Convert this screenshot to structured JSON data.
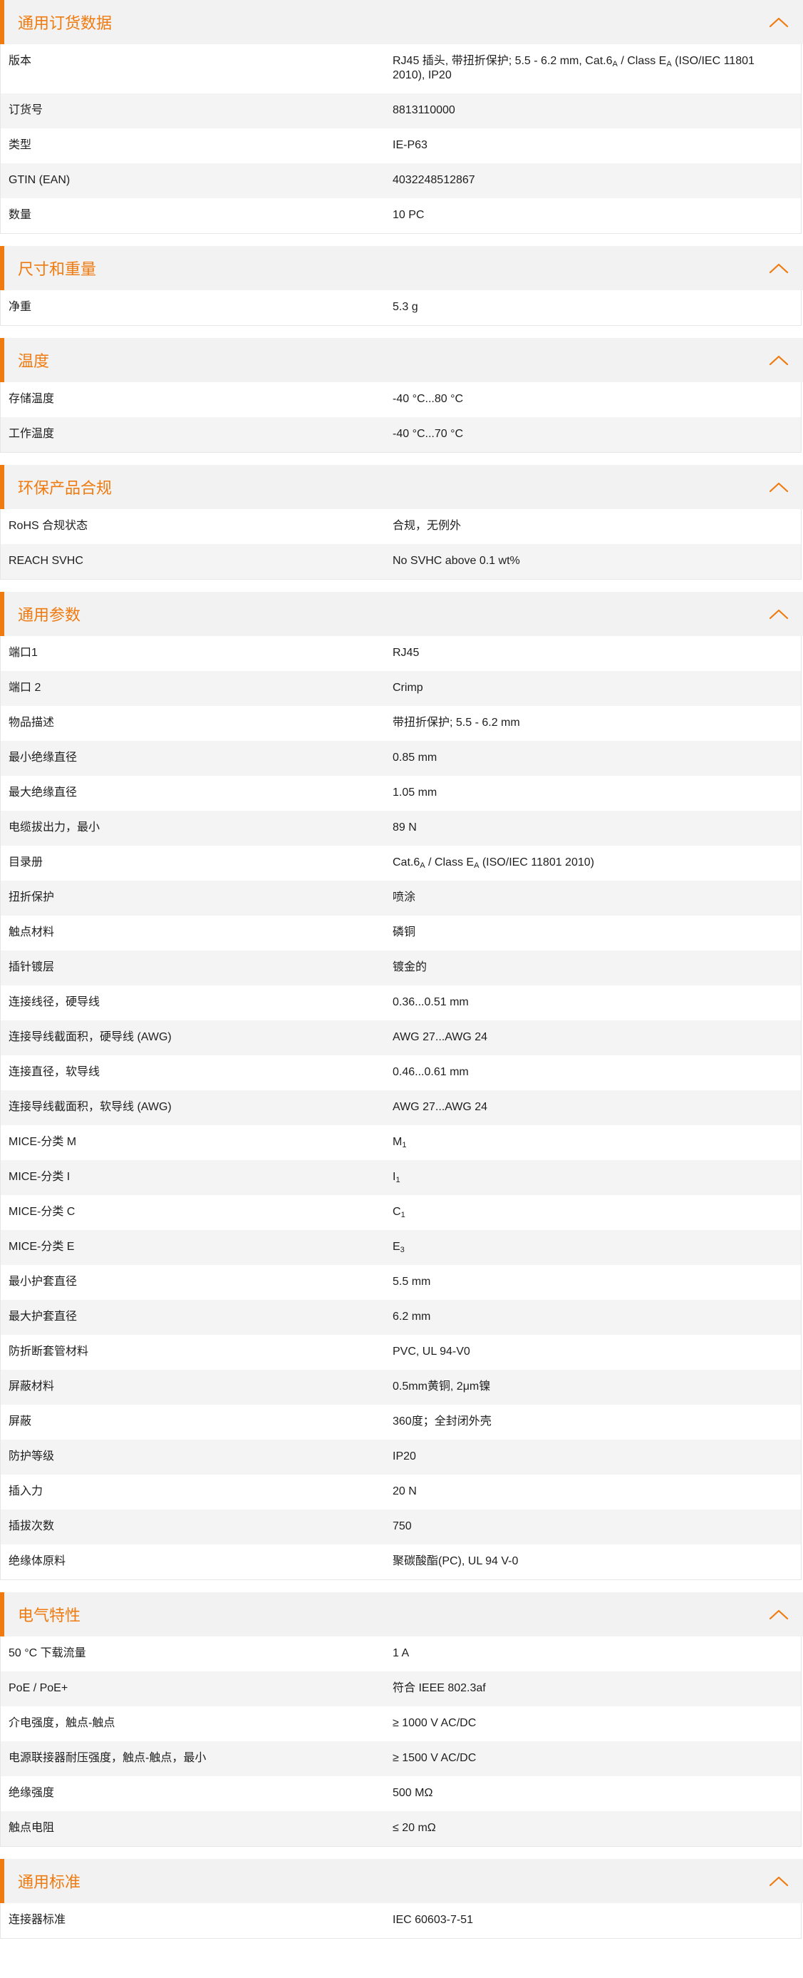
{
  "colors": {
    "accent": "#ef7b10",
    "header_bg": "#f2f2f2",
    "row_alt_bg": "#f4f4f4",
    "text": "#1e1e1e"
  },
  "icons": {
    "collapse": "chevron-up-icon"
  },
  "sections": [
    {
      "title": "通用订货数据",
      "rows": [
        {
          "label": "版本",
          "value": "RJ45 插头, 带扭折保护; 5.5 - 6.2 mm, Cat.6A / Class EA (ISO/IEC 11801 2010), IP20",
          "value_parts": [
            "RJ45 插头, 带扭折保护; 5.5 - 6.2 mm, Cat.6",
            "A",
            " / Class E",
            "A",
            " (ISO/IEC 11801 2010), IP20"
          ],
          "tall": true
        },
        {
          "label": "订货号",
          "value": "8813110000"
        },
        {
          "label": "类型",
          "value": "IE-P63"
        },
        {
          "label": "GTIN (EAN)",
          "value": "4032248512867"
        },
        {
          "label": "数量",
          "value": "10  PC"
        }
      ]
    },
    {
      "title": "尺寸和重量",
      "rows": [
        {
          "label": "净重",
          "value": "5.3  g"
        }
      ]
    },
    {
      "title": "温度",
      "rows": [
        {
          "label": "存储温度",
          "value": "-40 °C...80 °C"
        },
        {
          "label": "工作温度",
          "value": "-40 °C...70 °C"
        }
      ]
    },
    {
      "title": "环保产品合规",
      "rows": [
        {
          "label": "RoHS 合规状态",
          "value": "合规，无例外"
        },
        {
          "label": "REACH SVHC",
          "value": "No SVHC above 0.1 wt%"
        }
      ]
    },
    {
      "title": "通用参数",
      "rows": [
        {
          "label": "端口1",
          "value": "RJ45"
        },
        {
          "label": "端口 2",
          "value": "Crimp"
        },
        {
          "label": "物品描述",
          "value": "带扭折保护; 5.5 - 6.2 mm"
        },
        {
          "label": "最小绝缘直径",
          "value": "0.85  mm"
        },
        {
          "label": "最大绝缘直径",
          "value": "1.05  mm"
        },
        {
          "label": "电缆拔出力，最小",
          "value": "89  N"
        },
        {
          "label": "目录册",
          "value": "Cat.6A / Class EA (ISO/IEC 11801 2010)",
          "value_parts": [
            "Cat.6",
            "A",
            " / Class E",
            "A",
            " (ISO/IEC 11801 2010)"
          ]
        },
        {
          "label": "扭折保护",
          "value": "喷涂"
        },
        {
          "label": "触点材料",
          "value": "磷铜"
        },
        {
          "label": "插针镀层",
          "value": "镀金的"
        },
        {
          "label": "连接线径，硬导线",
          "value": "0.36...0.51 mm"
        },
        {
          "label": "连接导线截面积，硬导线 (AWG)",
          "value": "AWG 27...AWG 24"
        },
        {
          "label": "连接直径，软导线",
          "value": "0.46...0.61 mm"
        },
        {
          "label": "连接导线截面积，软导线 (AWG)",
          "value": "AWG 27...AWG 24"
        },
        {
          "label": "MICE-分类 M",
          "value": "M1",
          "value_parts": [
            "M",
            "1"
          ]
        },
        {
          "label": "MICE-分类 I",
          "value": "I1",
          "value_parts": [
            "I",
            "1"
          ]
        },
        {
          "label": "MICE-分类 C",
          "value": "C1",
          "value_parts": [
            "C",
            "1"
          ]
        },
        {
          "label": "MICE-分类 E",
          "value": "E3",
          "value_parts": [
            "E",
            "3"
          ]
        },
        {
          "label": "最小护套直径",
          "value": "5.5  mm"
        },
        {
          "label": "最大护套直径",
          "value": "6.2  mm"
        },
        {
          "label": "防折断套管材料",
          "value": "PVC, UL 94-V0"
        },
        {
          "label": "屏蔽材料",
          "value": "0.5mm黄铜, 2μm镍"
        },
        {
          "label": "屏蔽",
          "value": "360度；全封闭外壳"
        },
        {
          "label": "防护等级",
          "value": "IP20"
        },
        {
          "label": "插入力",
          "value": "20 N"
        },
        {
          "label": "插拔次数",
          "value": "750"
        },
        {
          "label": "绝缘体原料",
          "value": "聚碳酸酯(PC), UL 94 V-0"
        }
      ]
    },
    {
      "title": "电气特性",
      "rows": [
        {
          "label": "50 °C 下载流量",
          "value": "1  A"
        },
        {
          "label": "PoE / PoE+",
          "value": "符合 IEEE 802.3af"
        },
        {
          "label": "介电强度，触点-触点",
          "value": "≥ 1000 V AC/DC"
        },
        {
          "label": "电源联接器耐压强度，触点-触点，最小",
          "value": "≥ 1500 V AC/DC"
        },
        {
          "label": "绝缘强度",
          "value": "500 MΩ"
        },
        {
          "label": "触点电阻",
          "value": "≤ 20 mΩ"
        }
      ]
    },
    {
      "title": "通用标准",
      "rows": [
        {
          "label": "连接器标准",
          "value": "IEC 60603-7-51"
        }
      ]
    }
  ]
}
